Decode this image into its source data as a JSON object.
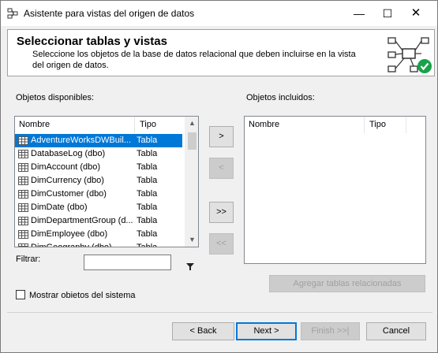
{
  "window": {
    "title": "Asistente para vistas del origen de datos",
    "minimize_glyph": "—",
    "maximize_glyph": "☐",
    "close_glyph": "✕"
  },
  "header": {
    "title": "Seleccionar tablas y vistas",
    "description": "Seleccione los objetos de la base de datos relacional que deben incluirse en la vista del origen de datos.",
    "graphic_icon": "database-diagram-check-icon"
  },
  "available": {
    "label": "Objetos disponibles:",
    "columns": [
      "Nombre",
      "Tipo"
    ],
    "rows": [
      {
        "name": "AdventureWorksDWBuil...",
        "type": "Tabla",
        "selected": true
      },
      {
        "name": "DatabaseLog (dbo)",
        "type": "Tabla",
        "selected": false
      },
      {
        "name": "DimAccount (dbo)",
        "type": "Tabla",
        "selected": false
      },
      {
        "name": "DimCurrency (dbo)",
        "type": "Tabla",
        "selected": false
      },
      {
        "name": "DimCustomer (dbo)",
        "type": "Tabla",
        "selected": false
      },
      {
        "name": "DimDate (dbo)",
        "type": "Tabla",
        "selected": false
      },
      {
        "name": "DimDepartmentGroup (d...",
        "type": "Tabla",
        "selected": false
      },
      {
        "name": "DimEmployee (dbo)",
        "type": "Tabla",
        "selected": false
      },
      {
        "name": "DimGeography (dbo)",
        "type": "Tabla",
        "selected": false
      }
    ]
  },
  "included": {
    "label": "Objetos incluidos:",
    "columns": [
      "Nombre",
      "Tipo"
    ]
  },
  "transfer_buttons": {
    "add": ">",
    "remove": "<",
    "add_all": ">>",
    "remove_all": "<<"
  },
  "filter": {
    "label": "Filtrar:",
    "value": "",
    "icon": "funnel-icon"
  },
  "add_related_button": "Agregar tablas relacionadas",
  "show_system_objects": {
    "label": "Mostrar obietos del sistema",
    "checked": false
  },
  "footer": {
    "back": "< Back",
    "next": "Next >",
    "finish": "Finish >>|",
    "cancel": "Cancel"
  }
}
